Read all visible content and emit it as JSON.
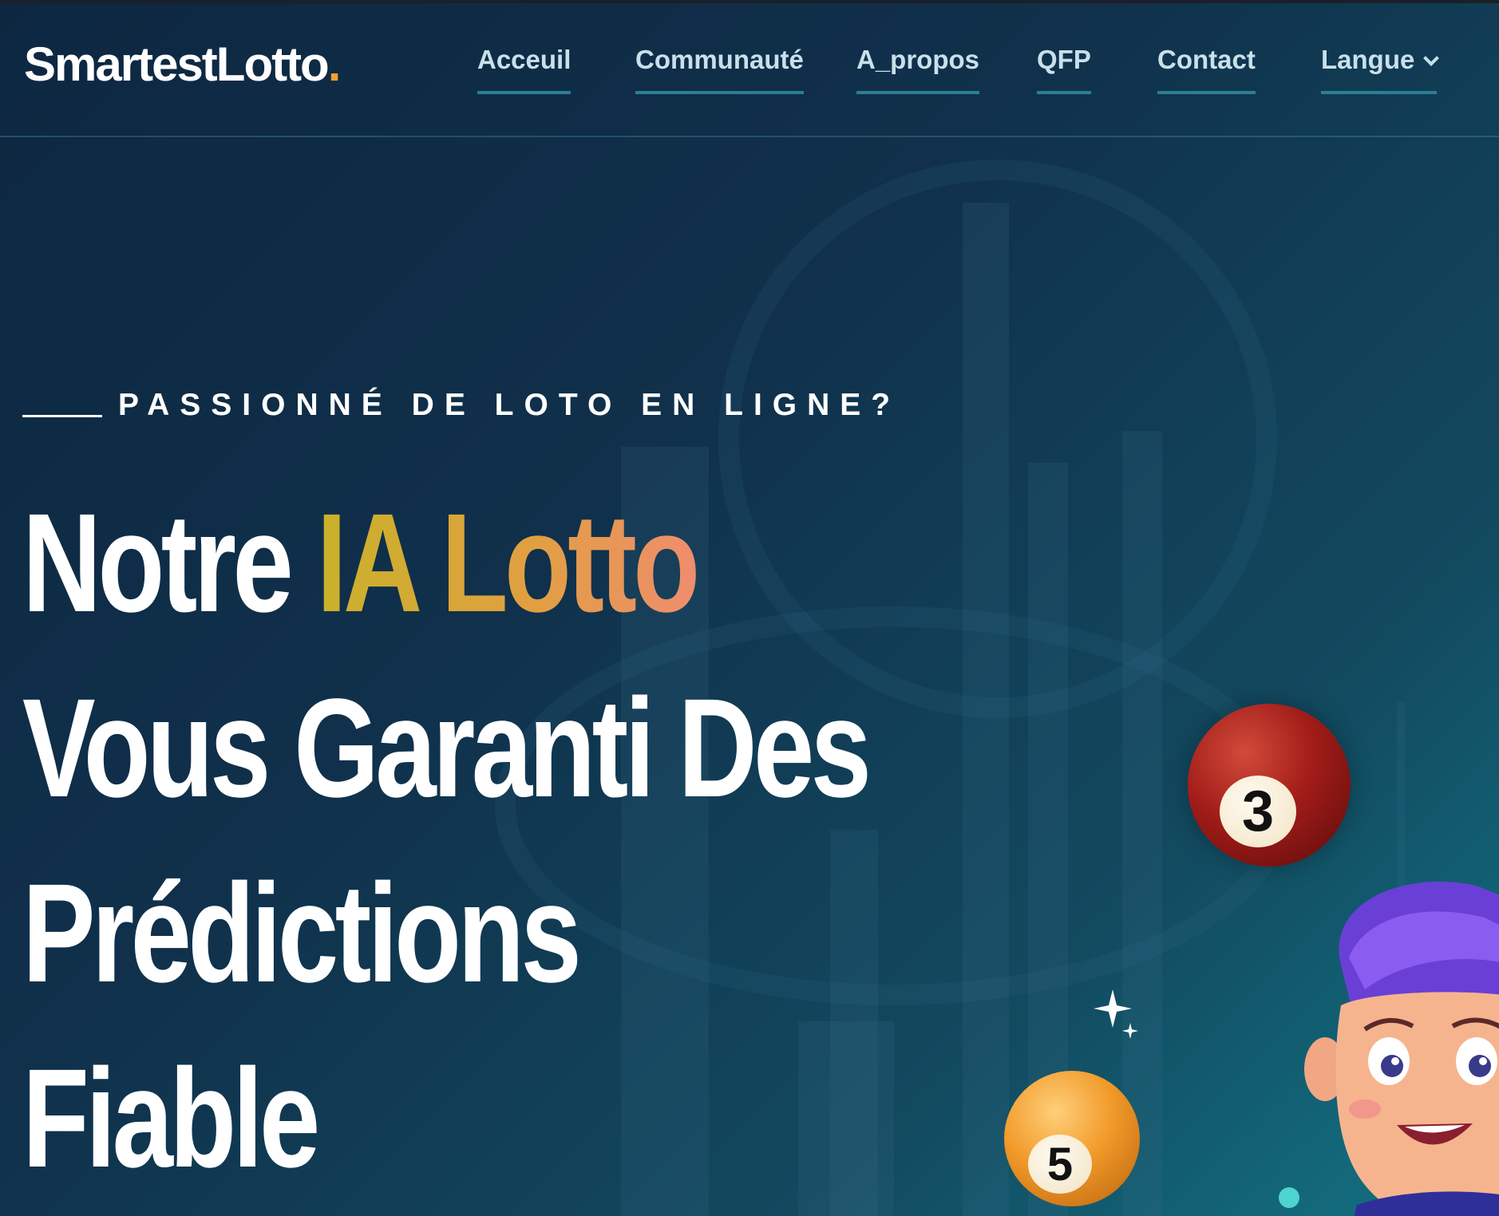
{
  "brand": {
    "name": "SmartestLotto",
    "dot": ".",
    "accent_color": "#f0a030"
  },
  "nav": {
    "items": [
      {
        "label": "Acceuil"
      },
      {
        "label": "Communauté"
      },
      {
        "label": "A_propos"
      },
      {
        "label": "QFP"
      },
      {
        "label": "Contact"
      },
      {
        "label": "Langue"
      }
    ],
    "underline_color": "#2a7f93"
  },
  "hero": {
    "kicker": "PASSIONNÉ DE LOTO EN LIGNE?",
    "headline": {
      "line1_prefix": "Notre",
      "line1_accent": "IA Lotto",
      "line2": "Vous Garanti Des",
      "line3": "Prédictions",
      "line4": "Fiable"
    },
    "accent_gradient": [
      "#c9b22a",
      "#e0a040",
      "#ef8d6e"
    ]
  },
  "decor": {
    "ball_red": {
      "number": "3"
    },
    "ball_orange": {
      "number": "5"
    }
  }
}
